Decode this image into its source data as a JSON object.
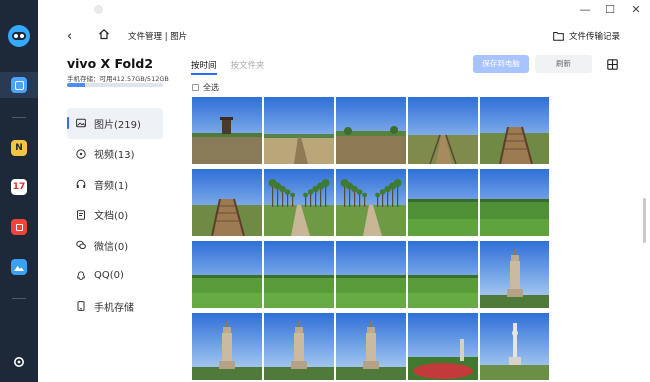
{
  "window": {
    "min_glyph": "—",
    "max_glyph": "☐",
    "close_glyph": "✕"
  },
  "nav": {
    "back_glyph": "‹",
    "path": "文件管理 | 图片",
    "transfer_label": "文件传输记录"
  },
  "device": {
    "name": "vivo X Fold2",
    "storage_text": "手机存储：可用412.57GB/512GB",
    "storage_used_fraction": 0.19
  },
  "categories": [
    {
      "label": "图片(219)",
      "icon": "image-icon",
      "active": true
    },
    {
      "label": "视频(13)",
      "icon": "video-icon",
      "active": false
    },
    {
      "label": "音频(1)",
      "icon": "headphones-icon",
      "active": false
    },
    {
      "label": "文档(0)",
      "icon": "document-icon",
      "active": false
    },
    {
      "label": "微信(0)",
      "icon": "wechat-icon",
      "active": false
    },
    {
      "label": "QQ(0)",
      "icon": "qq-icon",
      "active": false
    },
    {
      "label": "手机存储",
      "icon": "phone-storage-icon",
      "active": false
    }
  ],
  "tabs": [
    {
      "label": "按时间",
      "active": true
    },
    {
      "label": "按文件夹",
      "active": false
    }
  ],
  "toolbar": {
    "save_label": "保存到电脑",
    "refresh_label": "刷新"
  },
  "select_all_label": "全选",
  "rail": {
    "app_icons": [
      {
        "name": "notes-app-icon",
        "glyph": "N",
        "color": "#f5c542"
      },
      {
        "name": "calendar-app-icon",
        "glyph": "17",
        "color": "#ffffff"
      },
      {
        "name": "red-app-icon",
        "glyph": "",
        "color": "#f0433a"
      },
      {
        "name": "gallery-app-icon",
        "glyph": "",
        "color": "#3aa0f0"
      }
    ]
  },
  "photos": [
    "tower-field",
    "boardwalk-grass",
    "tree-field",
    "boardwalk-rails",
    "stairs-bridge",
    "stairs-bridge-2",
    "tree-path",
    "tree-path-2",
    "green-field",
    "green-field-2",
    "green-meadow",
    "green-meadow-2",
    "green-meadow-3",
    "green-meadow-4",
    "tower",
    "tower-2",
    "tower-3",
    "tower-4",
    "flower-bed",
    "tower-spire"
  ]
}
